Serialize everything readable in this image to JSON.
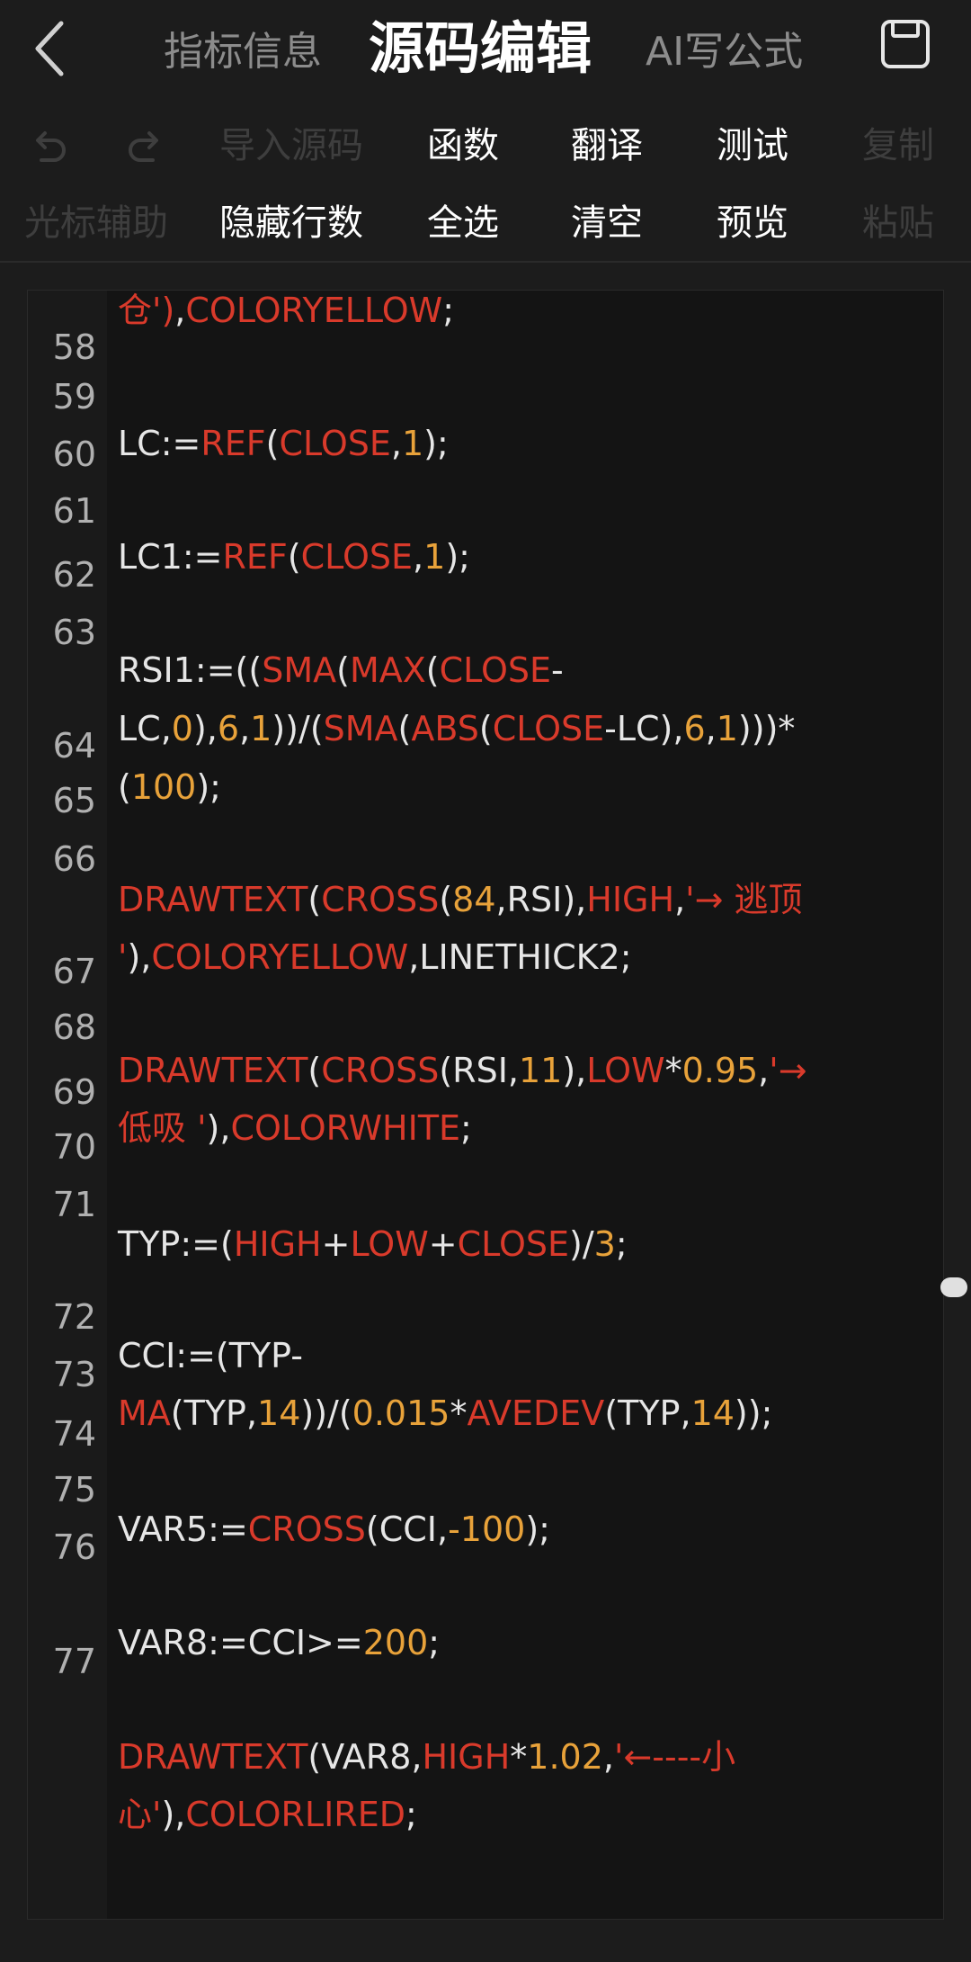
{
  "header": {
    "tabs": [
      "指标信息",
      "源码编辑",
      "AI写公式"
    ],
    "active_tab": "源码编辑",
    "icons": {
      "back": "chevron-left-icon",
      "save": "save-icon"
    }
  },
  "toolbar": {
    "row1": [
      "导入源码",
      "函数",
      "翻译",
      "测试",
      "复制"
    ],
    "row2": [
      "光标辅助",
      "隐藏行数",
      "全选",
      "清空",
      "预览",
      "粘贴"
    ],
    "icons": {
      "undo": "undo-icon",
      "redo": "redo-icon"
    }
  },
  "colors": {
    "keyword": "#d93a2b",
    "number": "#e8a23a",
    "text": "#e6e6e6",
    "background": "#1c1c1c"
  },
  "editor": {
    "line_numbers": [
      "58",
      "59",
      "60",
      "61",
      "62",
      "63",
      "64",
      "65",
      "66",
      "67",
      "68",
      "69",
      "70",
      "71",
      "72",
      "73",
      "74",
      "75",
      "76",
      "77"
    ],
    "code": [
      [
        [
          "k",
          "仓')"
        ],
        [
          "p",
          ","
        ],
        [
          "k",
          "COLORYELLOW"
        ],
        [
          "p",
          ";"
        ]
      ],
      [
        [
          "p",
          "LC:="
        ],
        [
          "k",
          "REF"
        ],
        [
          "p",
          "("
        ],
        [
          "k",
          "CLOSE"
        ],
        [
          "p",
          ","
        ],
        [
          "n",
          "1"
        ],
        [
          "p",
          ");"
        ]
      ],
      [
        [
          "p",
          "LC1:="
        ],
        [
          "k",
          "REF"
        ],
        [
          "p",
          "("
        ],
        [
          "k",
          "CLOSE"
        ],
        [
          "p",
          ","
        ],
        [
          "n",
          "1"
        ],
        [
          "p",
          ");"
        ]
      ],
      [
        [
          "p",
          "RSI1:=(("
        ],
        [
          "k",
          "SMA"
        ],
        [
          "p",
          "("
        ],
        [
          "k",
          "MAX"
        ],
        [
          "p",
          "("
        ],
        [
          "k",
          "CLOSE"
        ],
        [
          "p",
          "-"
        ]
      ],
      [
        [
          "p",
          "LC,"
        ],
        [
          "n",
          "0"
        ],
        [
          "p",
          "),"
        ],
        [
          "n",
          "6"
        ],
        [
          "p",
          ","
        ],
        [
          "n",
          "1"
        ],
        [
          "p",
          "))/("
        ],
        [
          "k",
          "SMA"
        ],
        [
          "p",
          "("
        ],
        [
          "k",
          "ABS"
        ],
        [
          "p",
          "("
        ],
        [
          "k",
          "CLOSE"
        ],
        [
          "p",
          "-LC),"
        ],
        [
          "n",
          "6"
        ],
        [
          "p",
          ","
        ],
        [
          "n",
          "1"
        ],
        [
          "p",
          ")))*"
        ]
      ],
      [
        [
          "p",
          "("
        ],
        [
          "n",
          "100"
        ],
        [
          "p",
          ");"
        ]
      ],
      [
        [
          "k",
          "DRAWTEXT"
        ],
        [
          "p",
          "("
        ],
        [
          "k",
          "CROSS"
        ],
        [
          "p",
          "("
        ],
        [
          "n",
          "84"
        ],
        [
          "p",
          ",RSI),"
        ],
        [
          "k",
          "HIGH"
        ],
        [
          "p",
          ","
        ],
        [
          "s",
          "'→ 逃顶"
        ]
      ],
      [
        [
          "s",
          "'"
        ],
        [
          "p",
          "),"
        ],
        [
          "k",
          "COLORYELLOW"
        ],
        [
          "p",
          ",LINETHICK2;"
        ]
      ],
      [
        [
          "k",
          "DRAWTEXT"
        ],
        [
          "p",
          "("
        ],
        [
          "k",
          "CROSS"
        ],
        [
          "p",
          "(RSI,"
        ],
        [
          "n",
          "11"
        ],
        [
          "p",
          "),"
        ],
        [
          "k",
          "LOW"
        ],
        [
          "p",
          "*"
        ],
        [
          "n",
          "0.95"
        ],
        [
          "p",
          ","
        ],
        [
          "s",
          "'→"
        ]
      ],
      [
        [
          "s",
          "低吸 '"
        ],
        [
          "p",
          "),"
        ],
        [
          "k",
          "COLORWHITE"
        ],
        [
          "p",
          ";"
        ]
      ],
      [
        [
          "p",
          "TYP:=("
        ],
        [
          "k",
          "HIGH"
        ],
        [
          "p",
          "+"
        ],
        [
          "k",
          "LOW"
        ],
        [
          "p",
          "+"
        ],
        [
          "k",
          "CLOSE"
        ],
        [
          "p",
          ")/"
        ],
        [
          "n",
          "3"
        ],
        [
          "p",
          ";"
        ]
      ],
      [
        [
          "p",
          "CCI:=(TYP-"
        ]
      ],
      [
        [
          "k",
          "MA"
        ],
        [
          "p",
          "(TYP,"
        ],
        [
          "n",
          "14"
        ],
        [
          "p",
          "))/("
        ],
        [
          "n",
          "0.015"
        ],
        [
          "p",
          "*"
        ],
        [
          "k",
          "AVEDEV"
        ],
        [
          "p",
          "(TYP,"
        ],
        [
          "n",
          "14"
        ],
        [
          "p",
          "));"
        ]
      ],
      [
        [
          "p",
          "VAR5:="
        ],
        [
          "k",
          "CROSS"
        ],
        [
          "p",
          "(CCI,"
        ],
        [
          "n",
          "-100"
        ],
        [
          "p",
          ");"
        ]
      ],
      [
        [
          "p",
          "VAR8:=CCI>="
        ],
        [
          "n",
          "200"
        ],
        [
          "p",
          ";"
        ]
      ],
      [
        [
          "k",
          "DRAWTEXT"
        ],
        [
          "p",
          "(VAR8,"
        ],
        [
          "k",
          "HIGH"
        ],
        [
          "p",
          "*"
        ],
        [
          "n",
          "1.02"
        ],
        [
          "p",
          ","
        ],
        [
          "s",
          "'←----小"
        ]
      ],
      [
        [
          "s",
          "心'"
        ],
        [
          "p",
          "),"
        ],
        [
          "k",
          "COLORLIRED"
        ],
        [
          "p",
          ";"
        ]
      ]
    ]
  }
}
